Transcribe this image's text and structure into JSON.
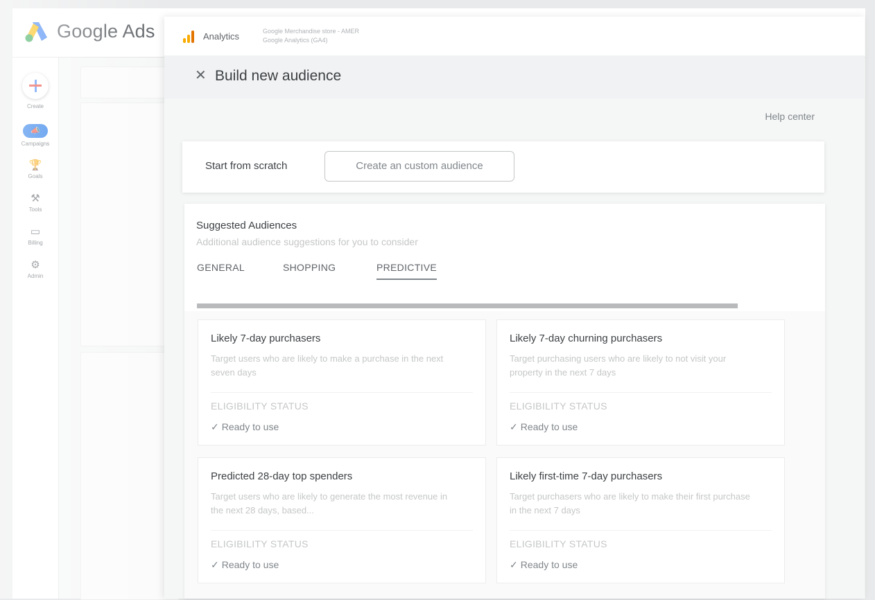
{
  "ads": {
    "brand": "Google Ads",
    "rail": [
      {
        "label": "Create",
        "icon": "plus-icon"
      },
      {
        "label": "Campaigns",
        "icon": "campaign-icon"
      },
      {
        "label": "Goals",
        "icon": "trophy-icon"
      },
      {
        "label": "Tools",
        "icon": "wrench-icon"
      },
      {
        "label": "Billing",
        "icon": "card-icon"
      },
      {
        "label": "Admin",
        "icon": "gear-icon"
      }
    ]
  },
  "analytics": {
    "product": "Analytics",
    "account_line1": "Google Merchandise store - AMER",
    "account_line2": "Google Analytics (GA4)"
  },
  "dialog": {
    "title": "Build new audience",
    "help": "Help center",
    "scratch_label": "Start from scratch",
    "custom_button": "Create an custom audience"
  },
  "suggested": {
    "title": "Suggested Audiences",
    "subtitle": "Additional audience suggestions for you to consider",
    "tabs": [
      {
        "label": "GENERAL",
        "active": false
      },
      {
        "label": "SHOPPING",
        "active": false
      },
      {
        "label": "PREDICTIVE",
        "active": true
      }
    ],
    "cards": [
      {
        "title": "Likely 7-day purchasers",
        "description": "Target users who are likely to make a purchase in the next seven days",
        "eligibility_label": "ELIGIBILITY STATUS",
        "status": "Ready to use"
      },
      {
        "title": "Likely 7-day churning purchasers",
        "description": "Target purchasing users who are likely to not visit your property in the next 7 days",
        "eligibility_label": "ELIGIBILITY STATUS",
        "status": "Ready to use"
      },
      {
        "title": "Predicted 28-day top spenders",
        "description": "Target users who are likely to generate the most revenue in the next 28 days, based...",
        "eligibility_label": "ELIGIBILITY STATUS",
        "status": "Ready to use"
      },
      {
        "title": "Likely first-time 7-day purchasers",
        "description": "Target purchasers who are likely to make their first purchase in the next 7 days",
        "eligibility_label": "ELIGIBILITY STATUS",
        "status": "Ready to use"
      }
    ]
  },
  "colors": {
    "ads_blue": "#1a73e8",
    "ga_orange": "#f9ab00",
    "text_primary": "#3c4043",
    "text_muted": "#c4c7c5"
  }
}
